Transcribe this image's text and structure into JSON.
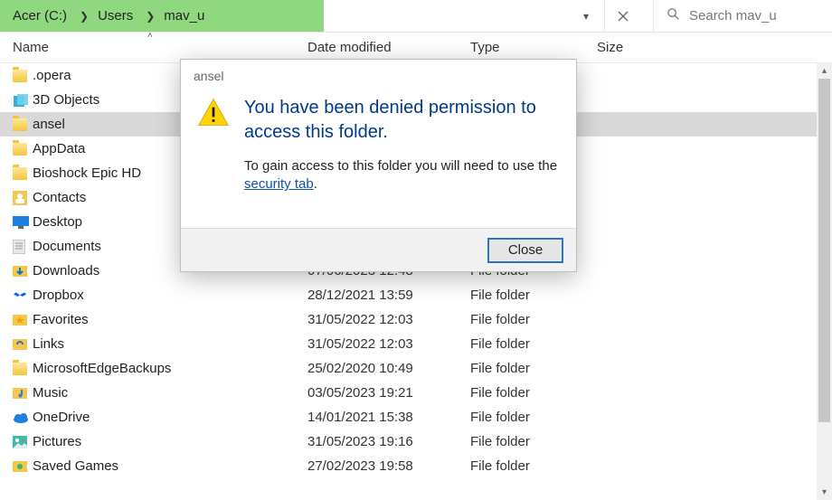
{
  "breadcrumb": {
    "items": [
      "Acer (C:)",
      "Users",
      "mav_u"
    ]
  },
  "search": {
    "placeholder": "Search mav_u"
  },
  "columns": {
    "name": "Name",
    "date": "Date modified",
    "type": "Type",
    "size": "Size"
  },
  "files": [
    {
      "name": ".opera",
      "date": "",
      "type": "",
      "icon": "folder",
      "selected": false
    },
    {
      "name": "3D Objects",
      "date": "",
      "type": "",
      "icon": "3d",
      "selected": false
    },
    {
      "name": "ansel",
      "date": "",
      "type": "",
      "icon": "folder",
      "selected": true
    },
    {
      "name": "AppData",
      "date": "",
      "type": "",
      "icon": "folder",
      "selected": false
    },
    {
      "name": "Bioshock Epic HD",
      "date": "",
      "type": "",
      "icon": "folder",
      "selected": false
    },
    {
      "name": "Contacts",
      "date": "",
      "type": "",
      "icon": "contacts",
      "selected": false
    },
    {
      "name": "Desktop",
      "date": "",
      "type": "",
      "icon": "desktop",
      "selected": false
    },
    {
      "name": "Documents",
      "date": "",
      "type": "",
      "icon": "doc",
      "selected": false
    },
    {
      "name": "Downloads",
      "date": "07/06/2023 12:48",
      "type": "File folder",
      "icon": "down",
      "selected": false
    },
    {
      "name": "Dropbox",
      "date": "28/12/2021 13:59",
      "type": "File folder",
      "icon": "dropbox",
      "selected": false
    },
    {
      "name": "Favorites",
      "date": "31/05/2022 12:03",
      "type": "File folder",
      "icon": "fav",
      "selected": false
    },
    {
      "name": "Links",
      "date": "31/05/2022 12:03",
      "type": "File folder",
      "icon": "links",
      "selected": false
    },
    {
      "name": "MicrosoftEdgeBackups",
      "date": "25/02/2020 10:49",
      "type": "File folder",
      "icon": "folder",
      "selected": false
    },
    {
      "name": "Music",
      "date": "03/05/2023 19:21",
      "type": "File folder",
      "icon": "music",
      "selected": false
    },
    {
      "name": "OneDrive",
      "date": "14/01/2021 15:38",
      "type": "File folder",
      "icon": "cloud",
      "selected": false
    },
    {
      "name": "Pictures",
      "date": "31/05/2023 19:16",
      "type": "File folder",
      "icon": "pic",
      "selected": false
    },
    {
      "name": "Saved Games",
      "date": "27/02/2023 19:58",
      "type": "File folder",
      "icon": "game",
      "selected": false
    }
  ],
  "dialog": {
    "title": "ansel",
    "heading": "You have been denied permission to access this folder.",
    "message_pre": "To gain access to this folder you will need to use the ",
    "link": "security tab",
    "message_post": ".",
    "close": "Close"
  }
}
